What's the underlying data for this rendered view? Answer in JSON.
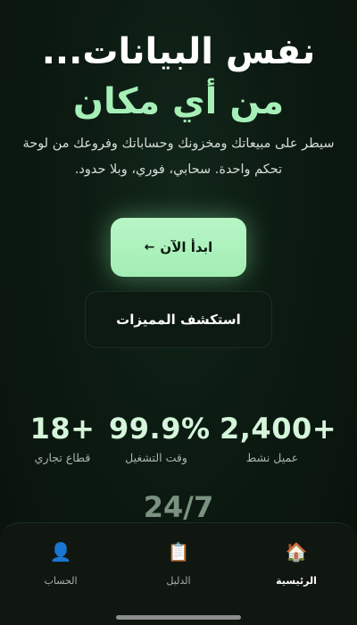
{
  "hero": {
    "title_line1": "نفس البيانات...",
    "title_line2": "من أي مكان",
    "subtitle": "سيطر على مبيعاتك ومخزونك وحساباتك وفروعك من لوحة تحكم واحدة. سحابي، فوري، وبلا حدود."
  },
  "cta": {
    "primary_label": "ابدأ الآن",
    "primary_arrow": "←",
    "secondary_label": "استكشف المميزات"
  },
  "stats": [
    {
      "value": "2,400+",
      "label": "عميل نشط"
    },
    {
      "value": "99.9%",
      "label": "وقت التشغيل"
    },
    {
      "value": "18+",
      "label": "قطاع تجاري"
    },
    {
      "value": "24/7",
      "label": ""
    }
  ],
  "nav": {
    "items": [
      {
        "label": "الرئيسية",
        "icon": "house-icon",
        "glyph": "🏠",
        "active": true
      },
      {
        "label": "الدليل",
        "icon": "clipboard-icon",
        "glyph": "📋",
        "active": false
      },
      {
        "label": "الحساب",
        "icon": "user-icon",
        "glyph": "👤",
        "active": false
      }
    ]
  }
}
